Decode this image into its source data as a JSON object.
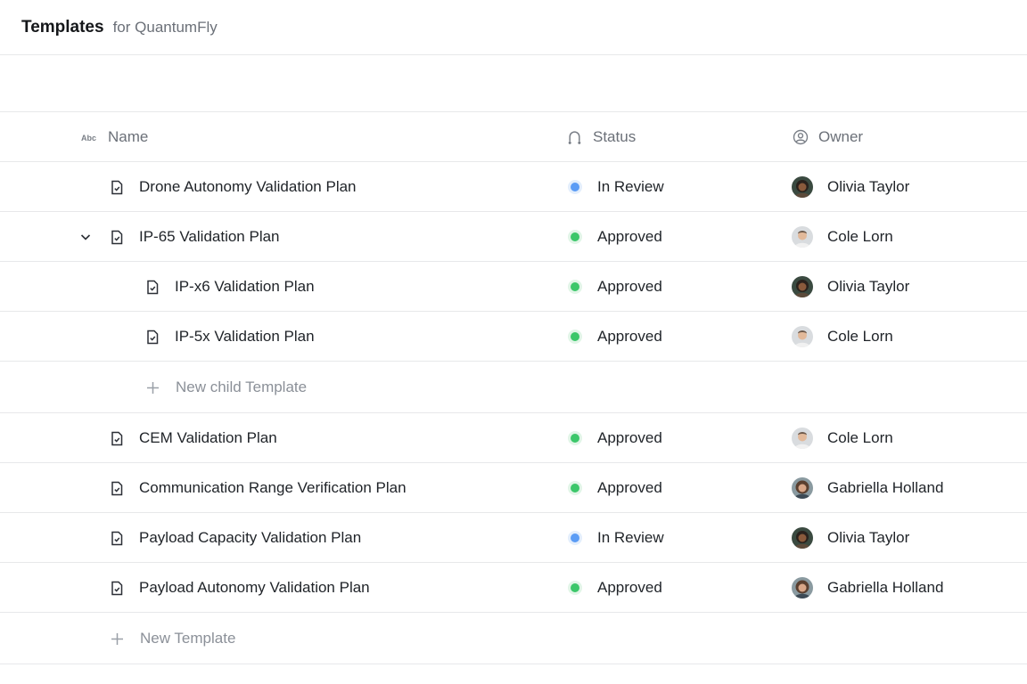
{
  "header": {
    "title": "Templates",
    "subtitle": "for QuantumFly"
  },
  "columns": {
    "name": "Name",
    "status": "Status",
    "owner": "Owner"
  },
  "rows": [
    {
      "name": "Drone Autonomy Validation Plan",
      "status": "In Review",
      "owner": "Olivia Taylor"
    },
    {
      "name": "IP-65 Validation Plan",
      "status": "Approved",
      "owner": "Cole Lorn"
    },
    {
      "name": "IP-x6 Validation Plan",
      "status": "Approved",
      "owner": "Olivia Taylor"
    },
    {
      "name": "IP-5x Validation Plan",
      "status": "Approved",
      "owner": "Cole Lorn"
    },
    {
      "name": "CEM Validation Plan",
      "status": "Approved",
      "owner": "Cole Lorn"
    },
    {
      "name": "Communication Range Verification Plan",
      "status": "Approved",
      "owner": "Gabriella Holland"
    },
    {
      "name": "Payload Capacity Validation Plan",
      "status": "In Review",
      "owner": "Olivia Taylor"
    },
    {
      "name": "Payload Autonomy Validation Plan",
      "status": "Approved",
      "owner": "Gabriella Holland"
    }
  ],
  "actions": {
    "new_child": "New child Template",
    "new_template": "New Template"
  },
  "colors": {
    "in_review": "#5b9cf5",
    "approved": "#3cc76a",
    "border": "#e7e8ea"
  },
  "icons": {
    "name_column": "text-abc-icon",
    "status_column": "status-flow-icon",
    "owner_column": "user-circle-icon",
    "row": "document-check-icon",
    "expand": "chevron-down-icon",
    "add": "plus-icon"
  }
}
